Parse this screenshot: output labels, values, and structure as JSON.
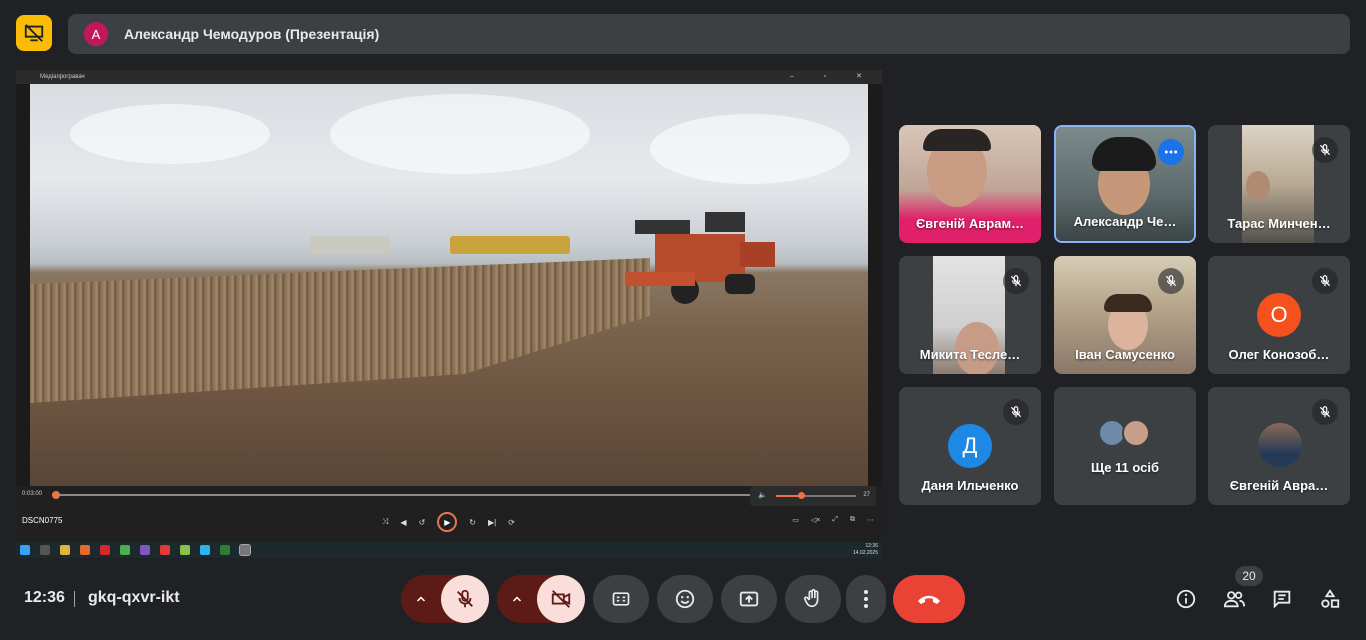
{
  "presenting": {
    "avatar_letter": "А",
    "text": "Александр Чемодуров (Презентація)"
  },
  "shared_screen": {
    "window_title": "Медіапрогравач",
    "file_name": "DSCN0775",
    "current_time": "0:03:00",
    "volume_value": "27",
    "taskbar_time": "12:36",
    "taskbar_date": "14.02.2025"
  },
  "participants": [
    {
      "name": "Євгеній Аврам…",
      "muted": false
    },
    {
      "name": "Александр Че…",
      "muted": false,
      "active": true
    },
    {
      "name": "Тарас Минчен…",
      "muted": true
    },
    {
      "name": "Микита Тесле…",
      "muted": true
    },
    {
      "name": "Іван Самусенко",
      "muted": true
    },
    {
      "name": "Олег Конозоб…",
      "muted": true,
      "letter": "О",
      "color": "#f4511e"
    },
    {
      "name": "Даня Ильченко",
      "muted": true,
      "letter": "Д",
      "color": "#1e88e5"
    },
    {
      "name": "Ще 11 осіб",
      "muted": false
    },
    {
      "name": "Євгеній Авра…",
      "muted": true
    }
  ],
  "bottom": {
    "time": "12:36",
    "meeting_code": "gkq-qxvr-ikt",
    "participant_count": "20"
  },
  "colors": {
    "accent_yellow": "#fbbc04",
    "end_call": "#ea4335",
    "active_border": "#8ab4f8",
    "danger_dark": "#5c1b17",
    "danger_light": "#f9dedc"
  },
  "icons": [
    "present-screen-off-icon",
    "mic-off-icon",
    "camera-off-icon",
    "captions-icon",
    "emoji-icon",
    "present-icon",
    "raise-hand-icon",
    "more-vert-icon",
    "end-call-icon",
    "info-icon",
    "people-icon",
    "chat-icon",
    "activities-icon"
  ]
}
